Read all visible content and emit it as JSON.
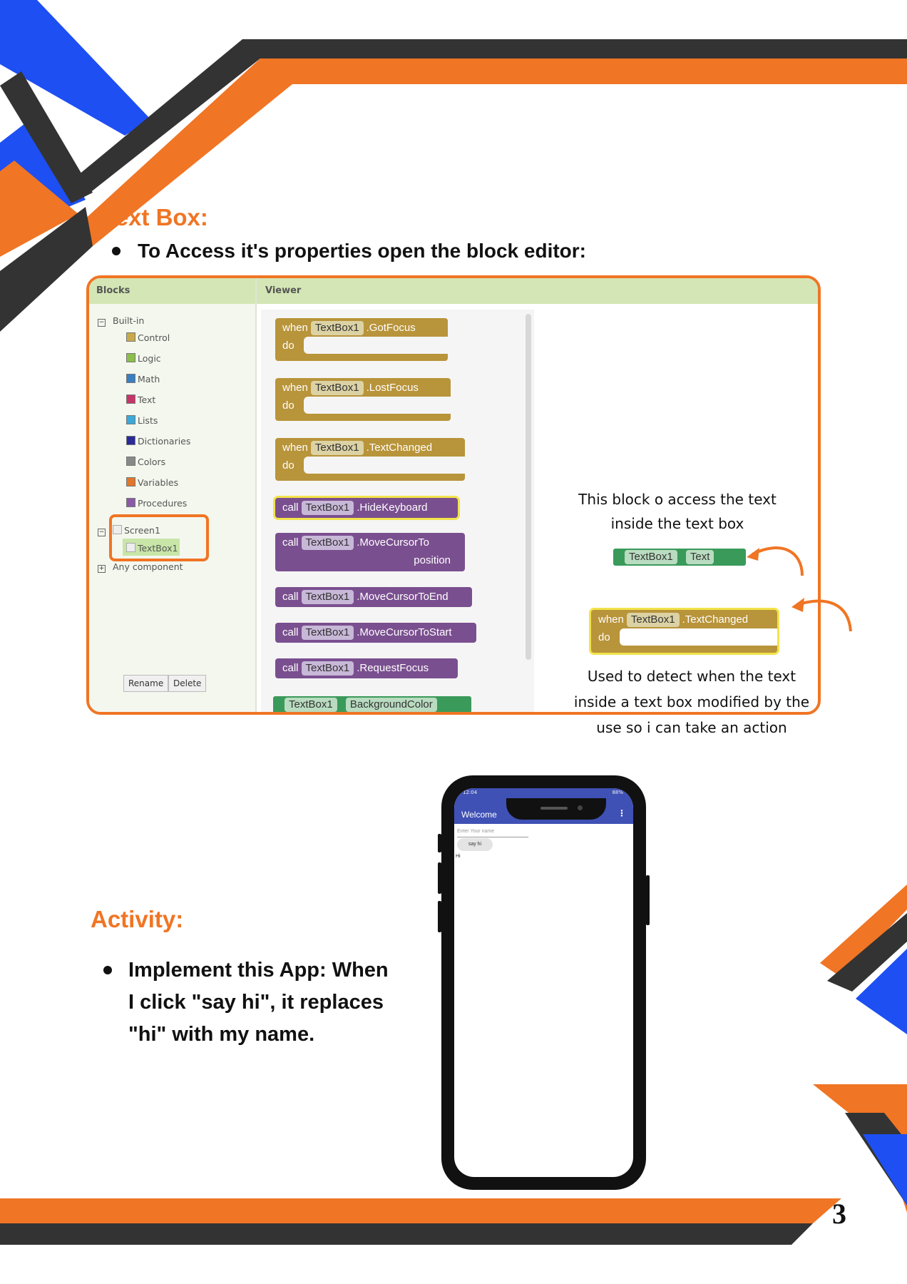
{
  "colors": {
    "orange": "#f07524",
    "dark": "#333333",
    "blue": "#1e4ff2",
    "block_event": "#b8943a",
    "block_call": "#7a4f8f",
    "block_green": "#3a9a5a",
    "appbar": "#3f51b5"
  },
  "textbox_section": {
    "title": "Text Box:",
    "bullet": "To Access it's properties open the block editor:"
  },
  "blocks_editor": {
    "blocks_header": "Blocks",
    "viewer_header": "Viewer",
    "builtin_label": "Built-in",
    "categories": [
      "Control",
      "Logic",
      "Math",
      "Text",
      "Lists",
      "Dictionaries",
      "Colors",
      "Variables",
      "Procedures"
    ],
    "category_colors": [
      "#c9a94a",
      "#8bbf4a",
      "#3a7fc1",
      "#c6356a",
      "#3aa8d8",
      "#2a2a9a",
      "#888888",
      "#e2762a",
      "#8a5aa8"
    ],
    "screen_label": "Screen1",
    "textbox_label": "TextBox1",
    "any_component": "Any component",
    "rename_button": "Rename",
    "delete_button": "Delete",
    "event_blocks": [
      {
        "when": "when",
        "component": "TextBox1",
        "event": ".GotFocus",
        "do": "do"
      },
      {
        "when": "when",
        "component": "TextBox1",
        "event": ".LostFocus",
        "do": "do"
      },
      {
        "when": "when",
        "component": "TextBox1",
        "event": ".TextChanged",
        "do": "do"
      }
    ],
    "call_blocks": [
      {
        "call": "call",
        "component": "TextBox1",
        "method": ".HideKeyboard"
      },
      {
        "call": "call",
        "component": "TextBox1",
        "method": ".MoveCursorTo",
        "arg": "position"
      },
      {
        "call": "call",
        "component": "TextBox1",
        "method": ".MoveCursorToEnd"
      },
      {
        "call": "call",
        "component": "TextBox1",
        "method": ".MoveCursorToStart"
      },
      {
        "call": "call",
        "component": "TextBox1",
        "method": ".RequestFocus"
      }
    ],
    "property_block": {
      "component": "TextBox1",
      "property": "BackgroundColor"
    }
  },
  "annotations": {
    "access_note_line1": "This block o access the text",
    "access_note_line2": "inside the text box",
    "getter_component": "TextBox1",
    "getter_property": "Text",
    "event_when": "when",
    "event_component": "TextBox1",
    "event_name": ".TextChanged",
    "event_do": "do",
    "detect_note_line1": "Used to detect when the text",
    "detect_note_line2": "inside a text box  modified by the",
    "detect_note_line3": "use so i can take an action"
  },
  "activity": {
    "title": "Activity:",
    "line1": "Implement this App: When",
    "line2": "I click \"say hi\", it replaces",
    "line3": "\"hi\" with my name."
  },
  "phone": {
    "status_left": "12:04",
    "status_right": "88%",
    "app_title": "Welcome",
    "input_placeholder": "Enter Your name",
    "button_label": "say hi",
    "label_text": "Hi"
  },
  "page_number": "3"
}
